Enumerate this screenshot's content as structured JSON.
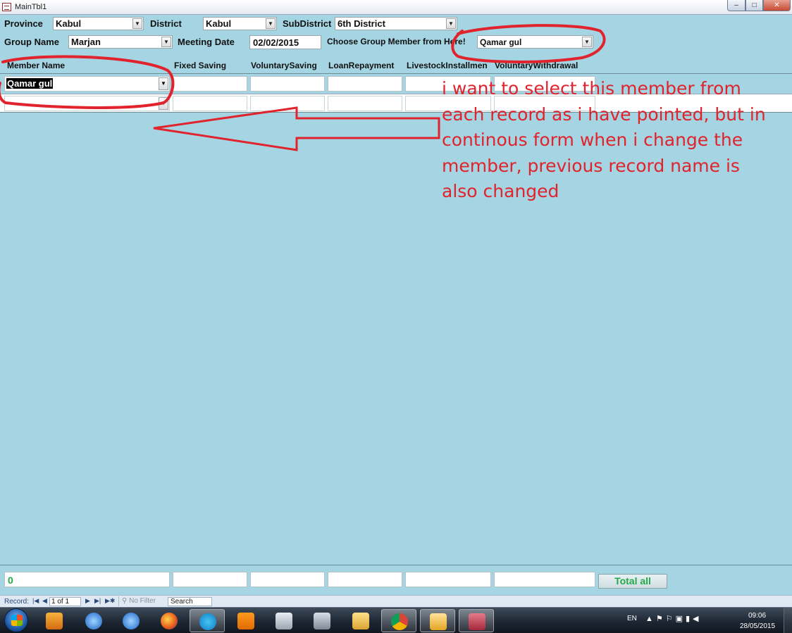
{
  "window": {
    "title": "MainTbl1"
  },
  "header": {
    "province_label": "Province",
    "province_value": "Kabul",
    "district_label": "District",
    "district_value": "Kabul",
    "subdistrict_label": "SubDistrict",
    "subdistrict_value": "6th District",
    "group_label": "Group Name",
    "group_value": "Marjan",
    "meeting_label": "Meeting Date",
    "meeting_value": "02/02/2015",
    "choose_label": "Choose Group Member from Here!",
    "choose_value": "Qamar gul"
  },
  "columns": [
    "Member Name",
    "Fixed Saving",
    "VoluntarySaving",
    "LoanRepayment",
    "LivestockInstallmen",
    "VoluntaryWithdrawal"
  ],
  "rows": [
    {
      "member": "Qamar gul"
    }
  ],
  "annotation": "i want to select this member from each record as i have pointed, but in continous form when i change the member, previous record name is also changed",
  "footer": {
    "total_value": "0",
    "total_button": "Total all"
  },
  "navbar": {
    "record_label": "Record:",
    "position": "1 of 1",
    "filter": "No Filter",
    "search": "Search"
  },
  "taskbar": {
    "apps": [
      "media-player-icon",
      "ie-icon",
      "ie-icon",
      "firefox-icon",
      "skype-icon",
      "vlc-icon",
      "scanner-icon",
      "camera-icon",
      "explorer-icon",
      "chrome-icon",
      "outlook-icon",
      "access-icon"
    ],
    "tray_lang": "EN",
    "time": "09:06",
    "date": "28/05/2015"
  },
  "colors": {
    "form_bg": "#a5d5e3",
    "annotation": "#e0232c",
    "total_green": "#23a94a"
  }
}
